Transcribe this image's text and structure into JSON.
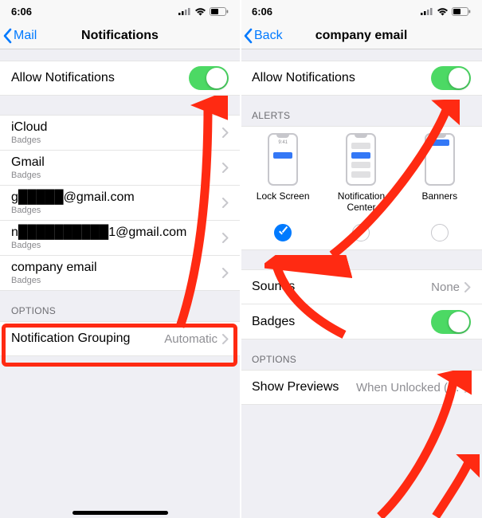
{
  "status": {
    "time": "6:06"
  },
  "left": {
    "back": "Mail",
    "title": "Notifications",
    "allow_label": "Allow Notifications",
    "accounts": [
      {
        "name": "iCloud",
        "sub": "Badges"
      },
      {
        "name": "Gmail",
        "sub": "Badges"
      },
      {
        "name": "g█████@gmail.com",
        "sub": "Badges"
      },
      {
        "name": "n██████████1@gmail.com",
        "sub": "Badges"
      },
      {
        "name": "company email",
        "sub": "Badges"
      }
    ],
    "options_header": "OPTIONS",
    "grouping_label": "Notification Grouping",
    "grouping_value": "Automatic"
  },
  "right": {
    "back": "Back",
    "title": "company email",
    "allow_label": "Allow Notifications",
    "alerts_header": "ALERTS",
    "alert_types": {
      "lock": "Lock Screen",
      "center": "Notification Center",
      "banners": "Banners",
      "t941": "9:41"
    },
    "sounds_label": "Sounds",
    "sounds_value": "None",
    "badges_label": "Badges",
    "options_header": "OPTIONS",
    "previews_label": "Show Previews",
    "previews_value": "When Unlocked (…"
  }
}
